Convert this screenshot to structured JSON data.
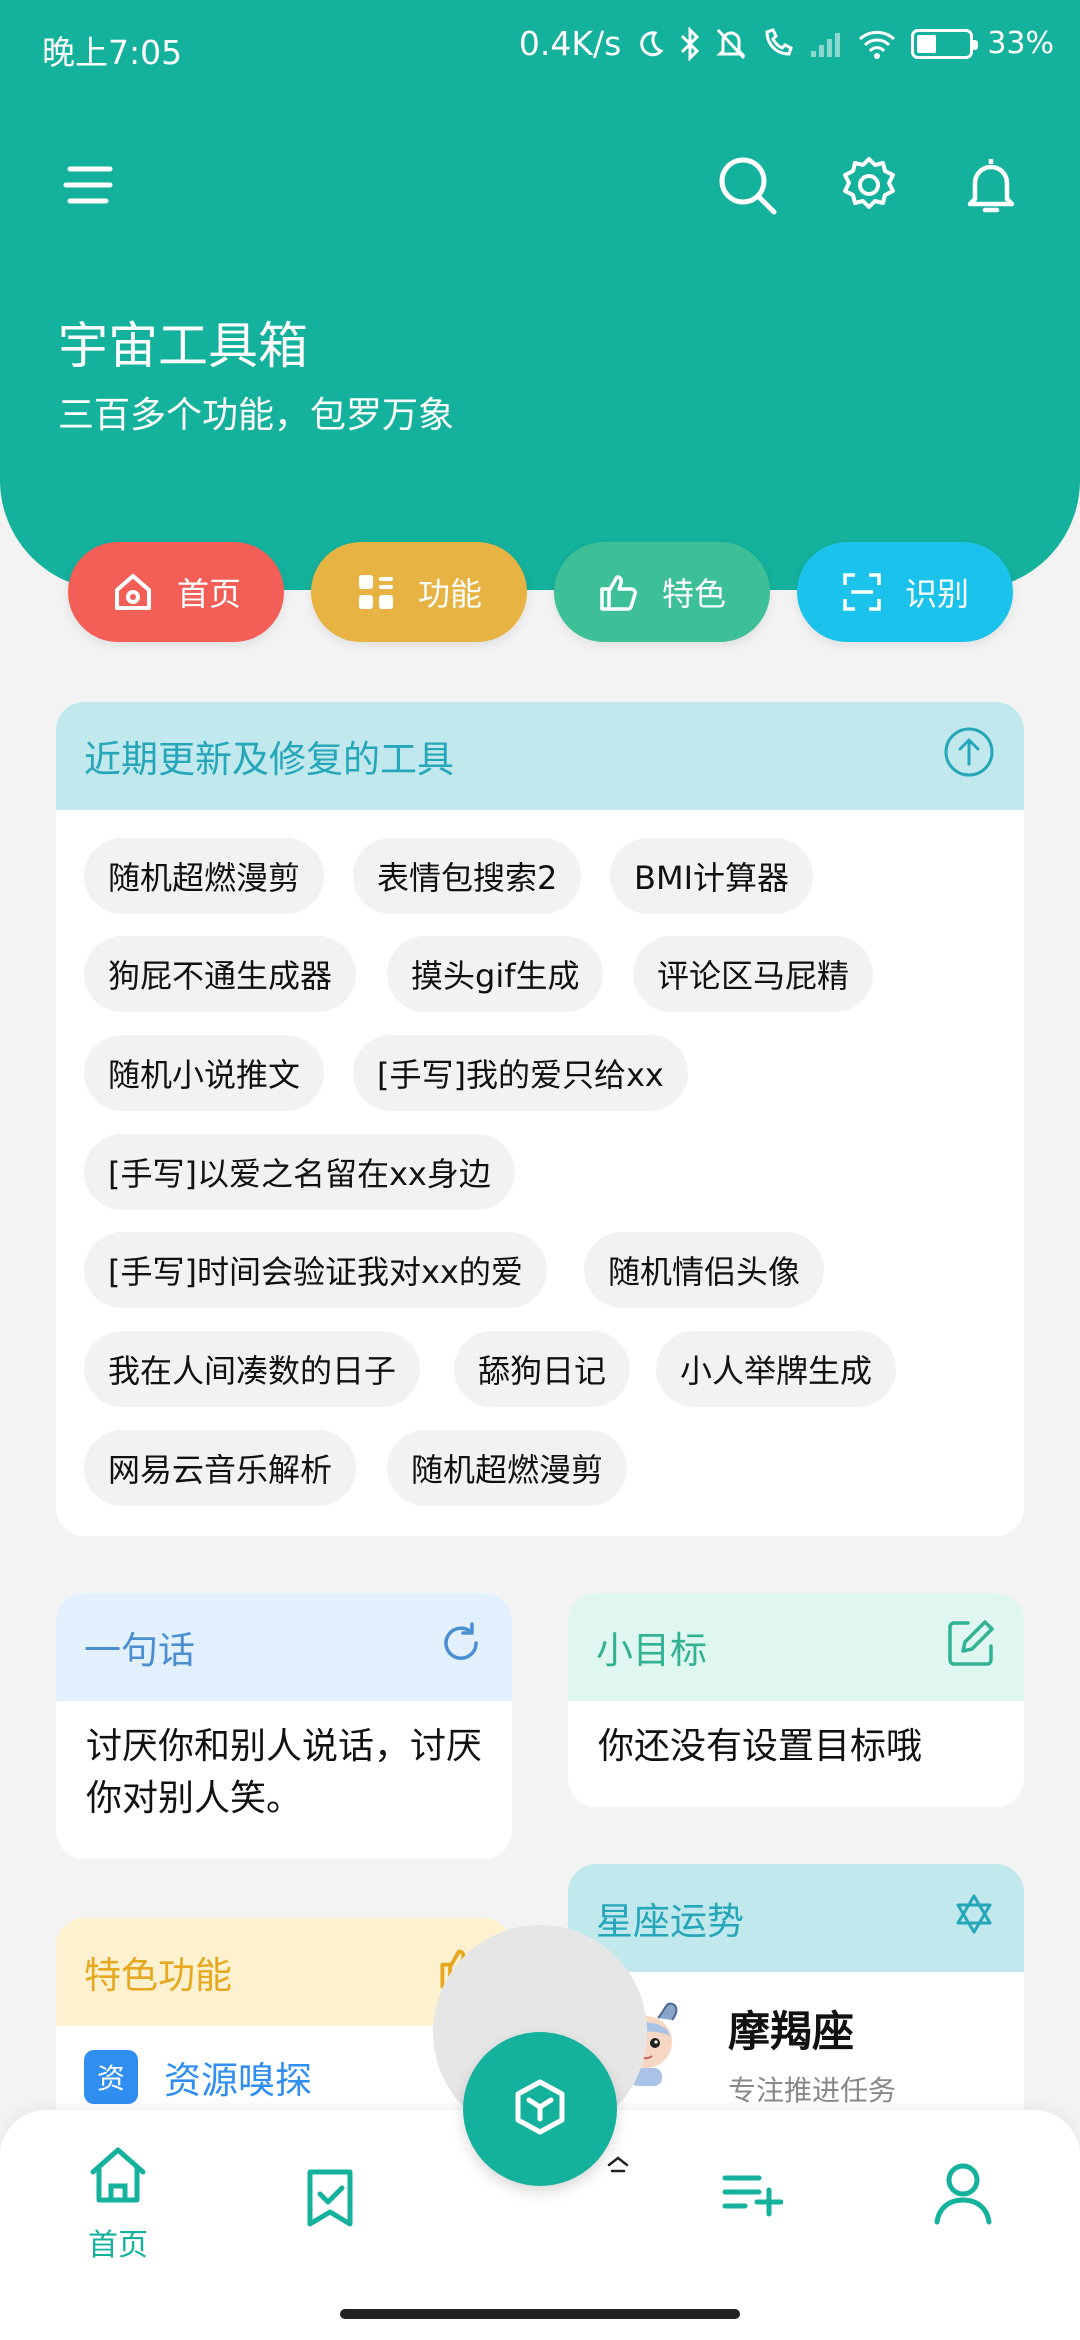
{
  "status_bar": {
    "time": "晚上7:05",
    "net_speed": "0.4K/s",
    "battery_pct": "33%",
    "battery_level": 0.33
  },
  "header": {
    "title": "宇宙工具箱",
    "subtitle": "三百多个功能，包罗万象"
  },
  "icons": {
    "menu": "menu-icon",
    "search": "search-icon",
    "settings": "gear-icon",
    "notifications": "bell-icon"
  },
  "quick_nav": [
    {
      "label": "首页",
      "icon": "home-icon",
      "color": "#f35e57"
    },
    {
      "label": "功能",
      "icon": "grid-icon",
      "color": "#e7b342"
    },
    {
      "label": "特色",
      "icon": "thumbs-up-icon",
      "color": "#3dbf98"
    },
    {
      "label": "识别",
      "icon": "scan-icon",
      "color": "#1bc3ec"
    }
  ],
  "recent_tools": {
    "title": "近期更新及修复的工具",
    "tags": [
      "随机超燃漫剪",
      "表情包搜索2",
      "BMI计算器",
      "狗屁不通生成器",
      "摸头gif生成",
      "评论区马屁精",
      "随机小说推文",
      "[手写]我的爱只给xx",
      "[手写]以爱之名留在xx身边",
      "[手写]时间会验证我对xx的爱",
      "随机情侣头像",
      "我在人间凑数的日子",
      "舔狗日记",
      "小人举牌生成",
      "网易云音乐解析",
      "随机超燃漫剪"
    ]
  },
  "quote_card": {
    "title": "一句话",
    "text": "讨厌你和别人说话，讨厌你对别人笑。"
  },
  "goal_card": {
    "title": "小目标",
    "text": "你还没有设置目标哦"
  },
  "featured_card": {
    "title": "特色功能",
    "item_badge": "资",
    "item_label": "资源嗅探"
  },
  "horoscope_card": {
    "title": "星座运势",
    "sign": "摩羯座",
    "desc": "专注推进任务"
  },
  "bottom_nav": {
    "home_label": "首页"
  },
  "colors": {
    "brand": "#14b19c"
  }
}
